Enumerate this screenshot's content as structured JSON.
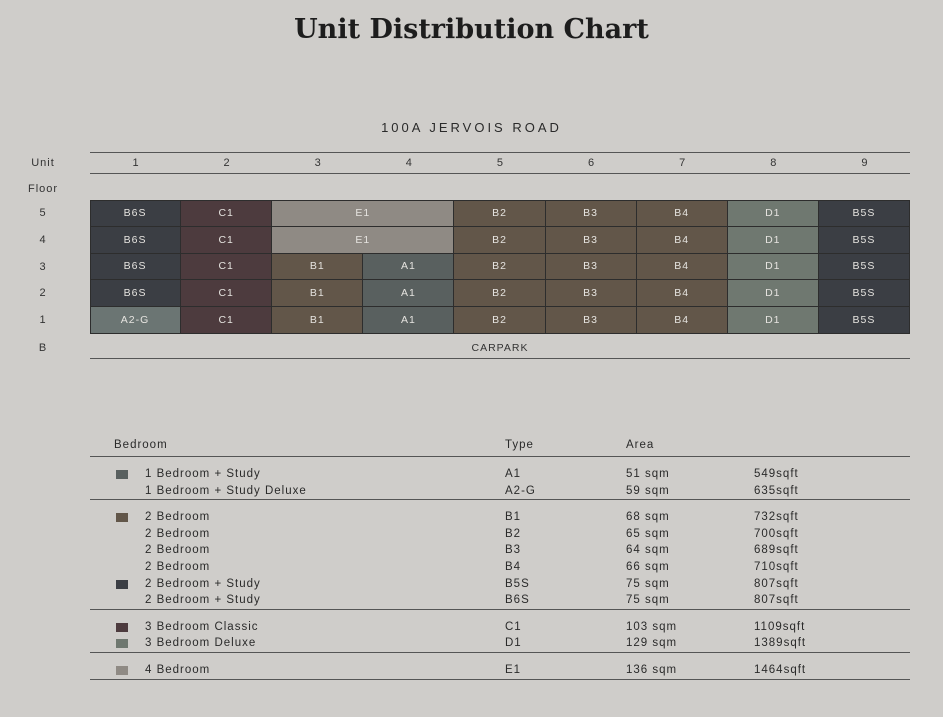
{
  "title": "Unit Distribution Chart",
  "subtitle": "100A JERVOIS ROAD",
  "labels": {
    "unit": "Unit",
    "floor": "Floor",
    "basement": "B",
    "carpark": "CARPARK"
  },
  "units": [
    "1",
    "2",
    "3",
    "4",
    "5",
    "6",
    "7",
    "8",
    "9"
  ],
  "floors": [
    {
      "label": "5",
      "cells": [
        {
          "t": "B6S",
          "c": "#3b3e44",
          "s": 1
        },
        {
          "t": "C1",
          "c": "#4d3b3e",
          "s": 1
        },
        {
          "t": "E1",
          "c": "#8f8a84",
          "s": 2
        },
        {
          "t": "B2",
          "c": "#625649",
          "s": 1
        },
        {
          "t": "B3",
          "c": "#625649",
          "s": 1
        },
        {
          "t": "B4",
          "c": "#625649",
          "s": 1
        },
        {
          "t": "D1",
          "c": "#6f7870",
          "s": 1
        },
        {
          "t": "B5S",
          "c": "#3b3e44",
          "s": 1
        }
      ]
    },
    {
      "label": "4",
      "cells": [
        {
          "t": "B6S",
          "c": "#3b3e44",
          "s": 1
        },
        {
          "t": "C1",
          "c": "#4d3b3e",
          "s": 1
        },
        {
          "t": "E1",
          "c": "#8f8a84",
          "s": 2
        },
        {
          "t": "B2",
          "c": "#625649",
          "s": 1
        },
        {
          "t": "B3",
          "c": "#625649",
          "s": 1
        },
        {
          "t": "B4",
          "c": "#625649",
          "s": 1
        },
        {
          "t": "D1",
          "c": "#6f7870",
          "s": 1
        },
        {
          "t": "B5S",
          "c": "#3b3e44",
          "s": 1
        }
      ]
    },
    {
      "label": "3",
      "cells": [
        {
          "t": "B6S",
          "c": "#3b3e44",
          "s": 1
        },
        {
          "t": "C1",
          "c": "#4d3b3e",
          "s": 1
        },
        {
          "t": "B1",
          "c": "#625649",
          "s": 1
        },
        {
          "t": "A1",
          "c": "#59605f",
          "s": 1
        },
        {
          "t": "B2",
          "c": "#625649",
          "s": 1
        },
        {
          "t": "B3",
          "c": "#625649",
          "s": 1
        },
        {
          "t": "B4",
          "c": "#625649",
          "s": 1
        },
        {
          "t": "D1",
          "c": "#6f7870",
          "s": 1
        },
        {
          "t": "B5S",
          "c": "#3b3e44",
          "s": 1
        }
      ]
    },
    {
      "label": "2",
      "cells": [
        {
          "t": "B6S",
          "c": "#3b3e44",
          "s": 1
        },
        {
          "t": "C1",
          "c": "#4d3b3e",
          "s": 1
        },
        {
          "t": "B1",
          "c": "#625649",
          "s": 1
        },
        {
          "t": "A1",
          "c": "#59605f",
          "s": 1
        },
        {
          "t": "B2",
          "c": "#625649",
          "s": 1
        },
        {
          "t": "B3",
          "c": "#625649",
          "s": 1
        },
        {
          "t": "B4",
          "c": "#625649",
          "s": 1
        },
        {
          "t": "D1",
          "c": "#6f7870",
          "s": 1
        },
        {
          "t": "B5S",
          "c": "#3b3e44",
          "s": 1
        }
      ]
    },
    {
      "label": "1",
      "cells": [
        {
          "t": "A2-G",
          "c": "#6b7573",
          "s": 1
        },
        {
          "t": "C1",
          "c": "#4d3b3e",
          "s": 1
        },
        {
          "t": "B1",
          "c": "#625649",
          "s": 1
        },
        {
          "t": "A1",
          "c": "#59605f",
          "s": 1
        },
        {
          "t": "B2",
          "c": "#625649",
          "s": 1
        },
        {
          "t": "B3",
          "c": "#625649",
          "s": 1
        },
        {
          "t": "B4",
          "c": "#625649",
          "s": 1
        },
        {
          "t": "D1",
          "c": "#6f7870",
          "s": 1
        },
        {
          "t": "B5S",
          "c": "#3b3e44",
          "s": 1
        }
      ]
    }
  ],
  "legend": {
    "headers": {
      "bedroom": "Bedroom",
      "type": "Type",
      "area": "Area"
    },
    "groups": [
      {
        "rows": [
          {
            "swatch": "#59605f",
            "bedroom": "1 Bedroom + Study",
            "type": "A1",
            "sqm": "51 sqm",
            "sqft": "549sqft"
          },
          {
            "swatch": null,
            "bedroom": "1 Bedroom + Study Deluxe",
            "type": "A2-G",
            "sqm": "59 sqm",
            "sqft": "635sqft"
          }
        ]
      },
      {
        "rows": [
          {
            "swatch": "#625649",
            "bedroom": "2 Bedroom",
            "type": "B1",
            "sqm": "68 sqm",
            "sqft": "732sqft"
          },
          {
            "swatch": null,
            "bedroom": "2 Bedroom",
            "type": "B2",
            "sqm": "65 sqm",
            "sqft": "700sqft"
          },
          {
            "swatch": null,
            "bedroom": "2 Bedroom",
            "type": "B3",
            "sqm": "64 sqm",
            "sqft": "689sqft"
          },
          {
            "swatch": null,
            "bedroom": "2 Bedroom",
            "type": "B4",
            "sqm": "66 sqm",
            "sqft": "710sqft"
          },
          {
            "swatch": "#3b3e44",
            "bedroom": "2 Bedroom + Study",
            "type": "B5S",
            "sqm": "75 sqm",
            "sqft": "807sqft"
          },
          {
            "swatch": null,
            "bedroom": "2 Bedroom + Study",
            "type": "B6S",
            "sqm": "75 sqm",
            "sqft": "807sqft"
          }
        ]
      },
      {
        "rows": [
          {
            "swatch": "#4d3b3e",
            "bedroom": "3 Bedroom Classic",
            "type": "C1",
            "sqm": "103 sqm",
            "sqft": "1109sqft"
          },
          {
            "swatch": "#6f7870",
            "bedroom": "3 Bedroom Deluxe",
            "type": "D1",
            "sqm": "129 sqm",
            "sqft": "1389sqft"
          }
        ]
      },
      {
        "rows": [
          {
            "swatch": "#8f8a84",
            "bedroom": "4 Bedroom",
            "type": "E1",
            "sqm": "136 sqm",
            "sqft": "1464sqft"
          }
        ]
      }
    ]
  }
}
